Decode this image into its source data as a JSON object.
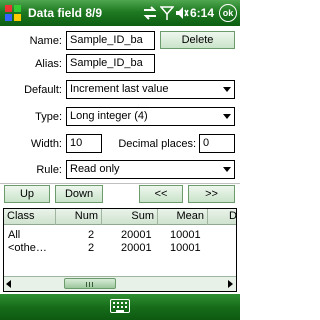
{
  "titlebar": {
    "title": "Data field 8/9",
    "time": "6:14",
    "ok_label": "ok"
  },
  "form": {
    "name_label": "Name:",
    "name_value": "Sample_ID_ba",
    "delete_label": "Delete",
    "alias_label": "Alias:",
    "alias_value": "Sample_ID_ba",
    "default_label": "Default:",
    "default_value": "Increment last value",
    "type_label": "Type:",
    "type_value": "Long integer (4)",
    "width_label": "Width:",
    "width_value": "10",
    "decimal_label": "Decimal places:",
    "decimal_value": "0",
    "rule_label": "Rule:",
    "rule_value": "Read only"
  },
  "nav": {
    "up": "Up",
    "down": "Down",
    "prev": "<<",
    "next": ">>"
  },
  "grid": {
    "columns": [
      "Class",
      "Num",
      "Sum",
      "Mean",
      "D"
    ],
    "rows": [
      [
        "All",
        "2",
        "20001",
        "10001"
      ],
      [
        "<othe…",
        "2",
        "20001",
        "10001"
      ]
    ]
  }
}
